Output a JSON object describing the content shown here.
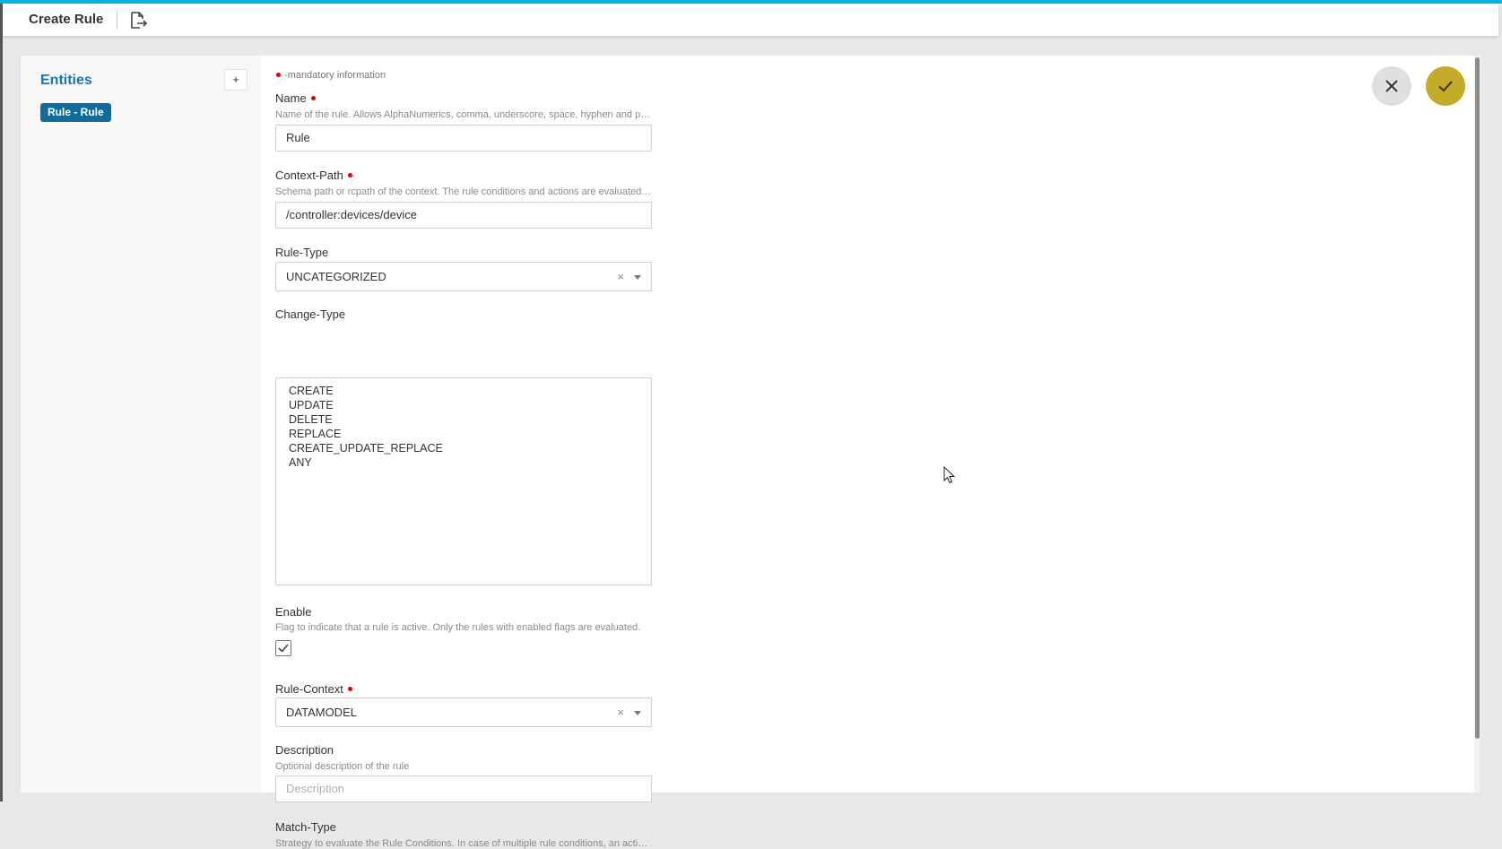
{
  "header": {
    "title": "Create Rule"
  },
  "sidebar": {
    "title": "Entities",
    "add_label": "+",
    "entity": "Rule - Rule"
  },
  "form": {
    "mandatory_note": "-mandatory information",
    "name": {
      "label": "Name",
      "hint": "Name of the rule. Allows AlphaNumerics, comma, underscore, space, hyphen and parant...",
      "value": "Rule"
    },
    "context_path": {
      "label": "Context-Path",
      "hint": "Schema path or rcpath of the context. The rule conditions and actions are evaluated und...",
      "value": "/controller:devices/device"
    },
    "rule_type": {
      "label": "Rule-Type",
      "value": "UNCATEGORIZED",
      "clear": "×"
    },
    "change_type": {
      "label": "Change-Type",
      "options": [
        "CREATE",
        "UPDATE",
        "DELETE",
        "REPLACE",
        "CREATE_UPDATE_REPLACE",
        "ANY"
      ]
    },
    "enable": {
      "label": "Enable",
      "hint": "Flag to indicate that a rule is active. Only the rules with enabled flags are evaluated.",
      "checked": true
    },
    "rule_context": {
      "label": "Rule-Context",
      "value": "DATAMODEL",
      "clear": "×"
    },
    "description": {
      "label": "Description",
      "hint": "Optional description of the rule",
      "placeholder": "Description"
    },
    "match_type": {
      "label": "Match-Type",
      "hint": "Strategy to evaluate the Rule Conditions. In case of multiple rule conditions, an action is e..."
    }
  },
  "colors": {
    "accent": "#00b4e6",
    "entity_chip": "#0f6d9c",
    "entities_title": "#1a73b0",
    "save_button": "#c4ac28",
    "mandatory_dot": "#e00000"
  },
  "icons": [
    "export-icon",
    "close-icon",
    "check-icon",
    "checkmark-icon",
    "chevron-down-icon",
    "mouse-cursor-icon"
  ]
}
